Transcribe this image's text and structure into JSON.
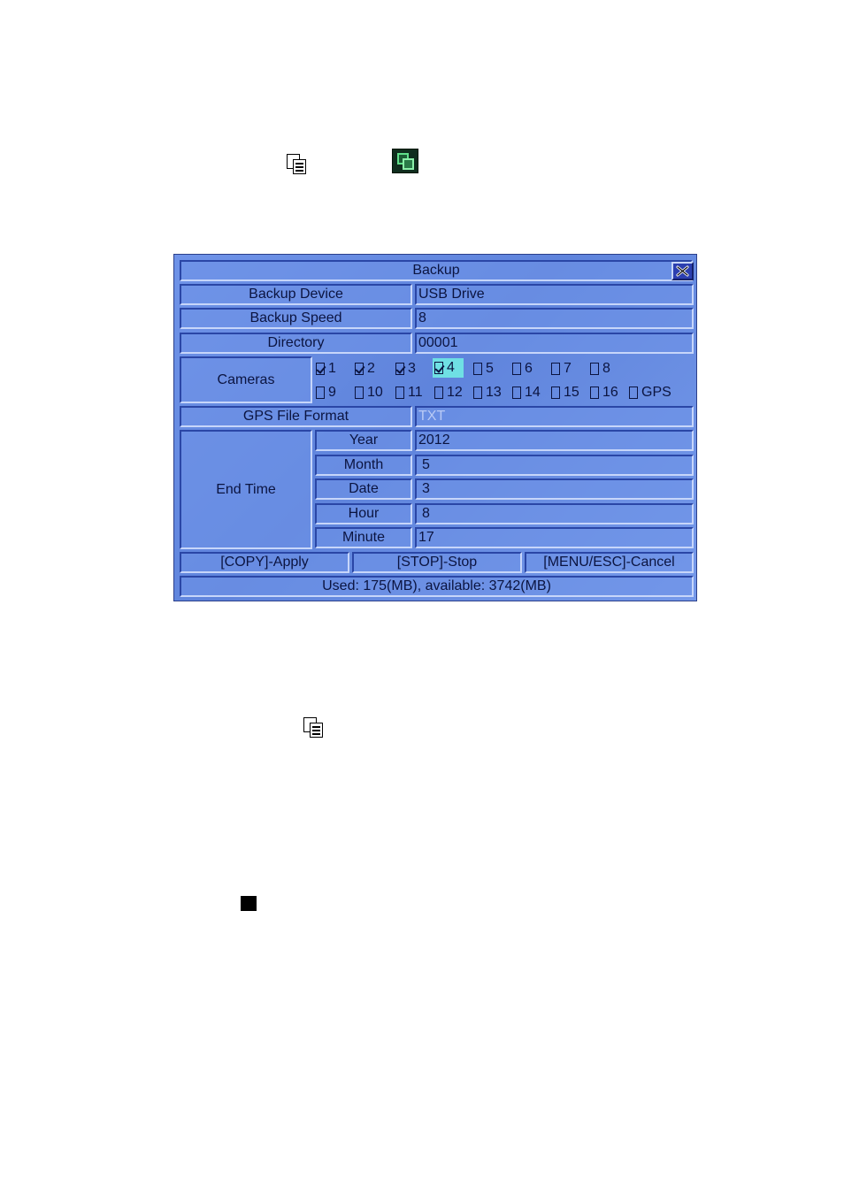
{
  "dialog": {
    "title": "Backup",
    "rows": {
      "backup_device": {
        "label": "Backup Device",
        "value": "USB Drive"
      },
      "backup_speed": {
        "label": "Backup Speed",
        "value": "8"
      },
      "directory": {
        "label": "Directory",
        "value": "00001"
      },
      "gps_file_format": {
        "label": "GPS File Format",
        "value": "TXT"
      }
    },
    "cameras": {
      "label": "Cameras",
      "items": [
        {
          "label": "1",
          "checked": true
        },
        {
          "label": "2",
          "checked": true
        },
        {
          "label": "3",
          "checked": true
        },
        {
          "label": "4",
          "checked": true,
          "selected": true
        },
        {
          "label": "5",
          "checked": false
        },
        {
          "label": "6",
          "checked": false
        },
        {
          "label": "7",
          "checked": false
        },
        {
          "label": "8",
          "checked": false
        },
        {
          "label": "9",
          "checked": false
        },
        {
          "label": "10",
          "checked": false
        },
        {
          "label": "11",
          "checked": false
        },
        {
          "label": "12",
          "checked": false
        },
        {
          "label": "13",
          "checked": false
        },
        {
          "label": "14",
          "checked": false
        },
        {
          "label": "15",
          "checked": false
        },
        {
          "label": "16",
          "checked": false
        },
        {
          "label": "GPS",
          "checked": false
        }
      ]
    },
    "end_time": {
      "label": "End Time",
      "fields": [
        {
          "label": "Year",
          "value": "2012"
        },
        {
          "label": "Month",
          "value": "5"
        },
        {
          "label": "Date",
          "value": "3"
        },
        {
          "label": "Hour",
          "value": "8"
        },
        {
          "label": "Minute",
          "value": "17"
        }
      ]
    },
    "buttons": {
      "apply": "[COPY]-Apply",
      "stop": "[STOP]-Stop",
      "cancel": "[MENU/ESC]-Cancel"
    },
    "status": "Used: 175(MB), available: 3742(MB)"
  },
  "icons": {
    "copy": "copy-icon",
    "backup": "backup-green-icon",
    "stop": "stop-square-icon",
    "close": "close-icon"
  },
  "colors": {
    "panel": "#6f93e8",
    "selection": "#6fe0e4",
    "text": "#0b1440",
    "close_button": "#2c3fb0"
  }
}
